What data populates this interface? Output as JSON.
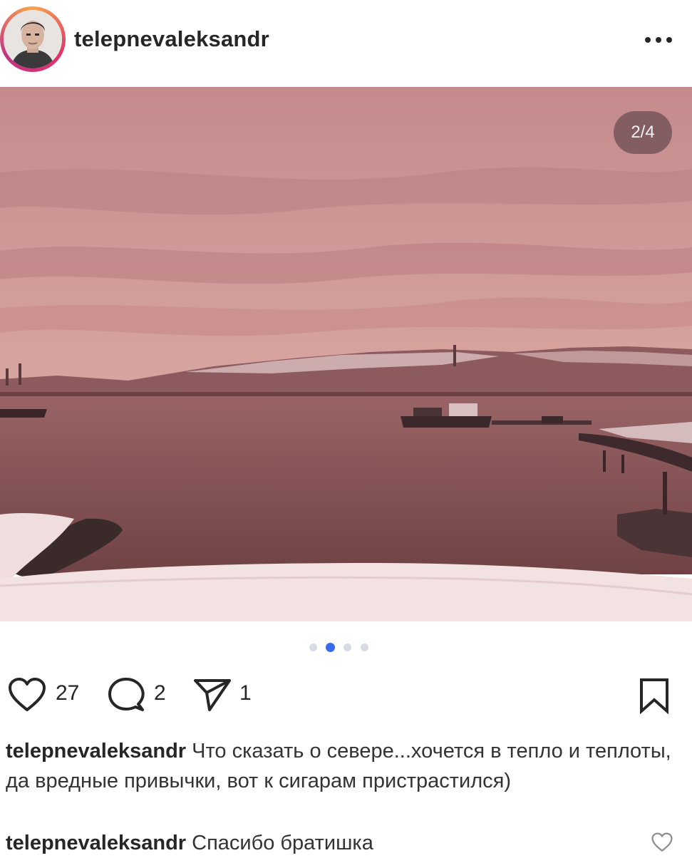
{
  "post": {
    "username": "telepnevaleksandr",
    "carousel_counter": "2/4",
    "carousel_dots": 4,
    "carousel_active_index": 1,
    "likes_count": "27",
    "comments_count": "2",
    "shares_count": "1",
    "caption_username": "telepnevaleksandr",
    "caption_text": "Что сказать о севере...хочется в тепло и теплоты, да вредные привычки, вот к сигарам пристрастился)"
  },
  "comment": {
    "username": "telepnevaleksandr",
    "text": "Спасибо братишка"
  },
  "icons": {
    "more": "more-horizontal-icon",
    "like": "heart-icon",
    "comment": "comment-bubble-icon",
    "share": "paper-plane-icon",
    "save": "bookmark-icon"
  },
  "colors": {
    "accent_dot": "#3b6af0",
    "sky": "#c98f90",
    "water": "#7a4a4c"
  }
}
